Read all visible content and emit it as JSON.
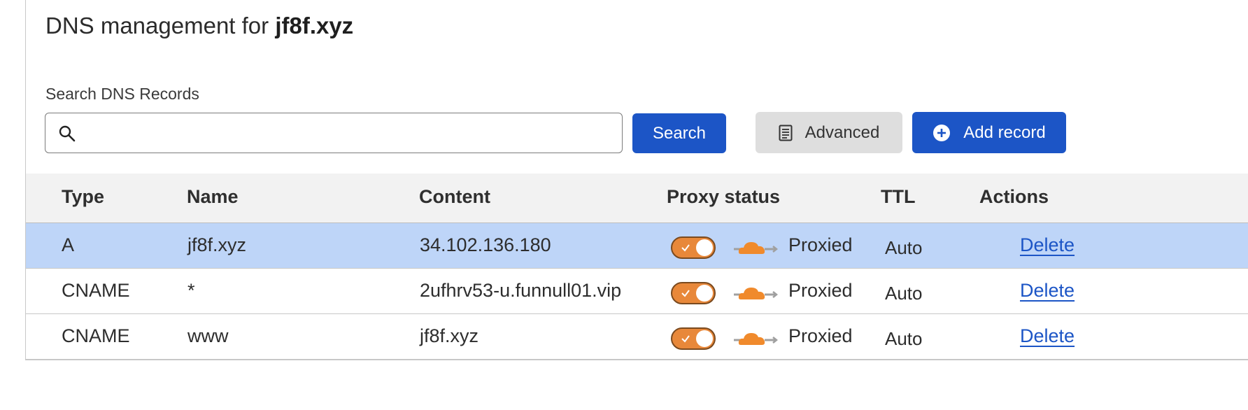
{
  "page": {
    "title_prefix": "DNS management for ",
    "title_domain": "jf8f.xyz"
  },
  "search": {
    "label": "Search DNS Records",
    "value": "",
    "placeholder": "",
    "button_label": "Search"
  },
  "toolbar": {
    "advanced_label": "Advanced",
    "add_record_label": "Add record"
  },
  "table": {
    "columns": [
      "Type",
      "Name",
      "Content",
      "Proxy status",
      "TTL",
      "Actions"
    ],
    "rows": [
      {
        "type": "A",
        "name": "jf8f.xyz",
        "content": "34.102.136.180",
        "proxy": "Proxied",
        "ttl": "Auto",
        "action": "Delete",
        "selected": true
      },
      {
        "type": "CNAME",
        "name": "*",
        "content": "2ufhrv53-u.funnull01.vip",
        "proxy": "Proxied",
        "ttl": "Auto",
        "action": "Delete",
        "selected": false
      },
      {
        "type": "CNAME",
        "name": "www",
        "content": "jf8f.xyz",
        "proxy": "Proxied",
        "ttl": "Auto",
        "action": "Delete",
        "selected": false
      }
    ]
  },
  "icons": {
    "search": "search-icon",
    "advanced": "document-list-icon",
    "add": "plus-circle-icon",
    "proxy": "cloud-arrow-icon",
    "toggle_check": "check-icon"
  },
  "colors": {
    "primary_button": "#1c55c6",
    "selected_row": "#bed5f8",
    "proxy_orange": "#e8883a",
    "header_bg": "#f2f2f2"
  }
}
